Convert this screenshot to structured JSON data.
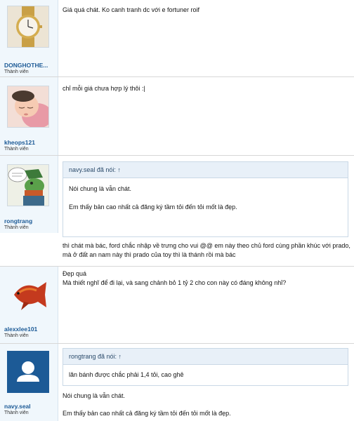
{
  "posts": [
    {
      "username": "DONGHOTHE...",
      "user_title": "Thành viên",
      "avatar_icon": "gold-wristwatch",
      "message": "Giá quá chát. Ko canh tranh dc với e fortuner roif"
    },
    {
      "username": "kheops121",
      "user_title": "Thành viên",
      "avatar_icon": "sleeping-baby",
      "message": "chỉ mỗi giá chưa hợp lý thôi :|"
    },
    {
      "username": "rongtrang",
      "user_title": "Thành viên",
      "avatar_icon": "cartoon-crocodile",
      "quote": {
        "header": "navy.seal đã nói: ↑",
        "lines": [
          "Nói chung là vẫn chát.",
          "Em thấy bản cao nhất cả đăng ký tầm tỏi đến tỏi mốt là đẹp."
        ]
      },
      "message_lines": [
        "thì chát mà bác, ford chắc nhập về trưng cho vui @@ em này theo chủ ford cùng phần khúc với prado,",
        "mà ở đất an nam này thì prado của toy thì là thánh rồi mà bác"
      ]
    },
    {
      "username": "alexxlee101",
      "user_title": "Thành viên",
      "avatar_icon": "arowana-fish",
      "message_lines": [
        "Đẹp quá",
        "Mà thiết nghĩ để đi lại, và sang chảnh bỏ 1 tỷ 2 cho con này có đáng không nhỉ?"
      ]
    },
    {
      "username": "navy.seal",
      "user_title": "Thành viên",
      "avatar_icon": "default-user",
      "quote": {
        "header": "rongtrang đã nói: ↑",
        "lines": [
          "lăn bánh được chắc phải 1,4 tỏi, cao ghê"
        ]
      },
      "message_lines": [
        "Nói chung là vẫn chát.",
        "Em thấy bản cao nhất cả đăng ký tầm tỏi đến tỏi mốt là đẹp."
      ]
    }
  ]
}
